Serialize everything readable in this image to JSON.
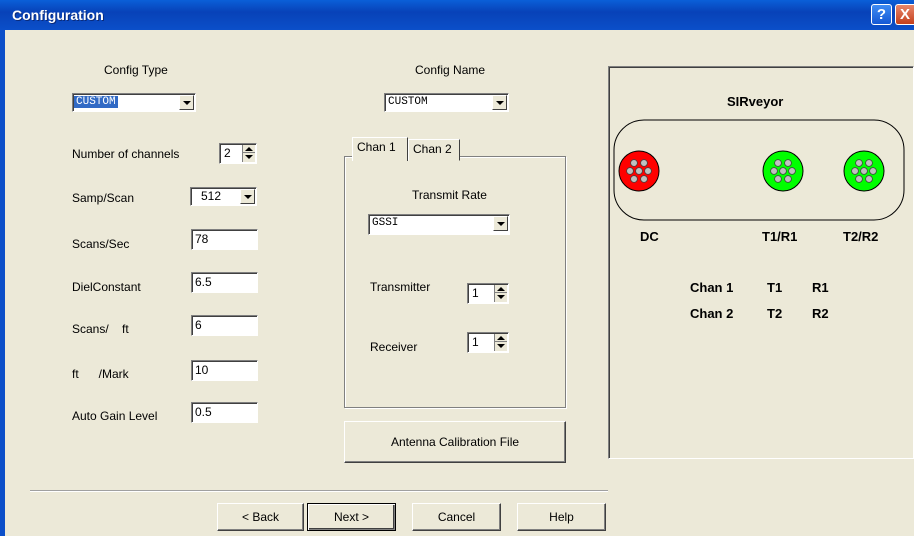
{
  "window": {
    "title": "Configuration",
    "help_glyph": "?",
    "close_glyph": "X"
  },
  "left": {
    "config_type_label": "Config Type",
    "config_type_value": "CUSTOM",
    "num_channels_label": "Number of channels",
    "num_channels_value": "2",
    "samp_scan_label": "Samp/Scan",
    "samp_scan_value": "512",
    "scans_sec_label": "Scans/Sec",
    "scans_sec_value": "78",
    "diel_label": "DielConstant",
    "diel_value": "6.5",
    "scans_ft_label": "Scans/    ft",
    "scans_ft_value": "6",
    "ft_mark_label": "ft      /Mark",
    "ft_mark_value": "10",
    "agc_label": "Auto Gain Level",
    "agc_value": "0.5"
  },
  "middle": {
    "config_name_label": "Config Name",
    "config_name_value": "CUSTOM",
    "tabs": [
      "Chan 1",
      "Chan 2"
    ],
    "transmit_rate_label": "Transmit Rate",
    "transmit_rate_value": "GSSI",
    "transmitter_label": "Transmitter",
    "transmitter_value": "1",
    "receiver_label": "Receiver",
    "receiver_value": "1",
    "calib_button": "Antenna Calibration File"
  },
  "sirveyor": {
    "title": "SIRveyor",
    "ports": [
      "DC",
      "T1/R1",
      "T2/R2"
    ],
    "port_colors": {
      "dc": "#ff0000",
      "t1r1": "#00ff00",
      "t2r2": "#00ff00"
    },
    "rows": [
      {
        "chan": "Chan 1",
        "t": "T1",
        "r": "R1"
      },
      {
        "chan": "Chan 2",
        "t": "T2",
        "r": "R2"
      }
    ]
  },
  "footer": {
    "back": "< Back",
    "next": "Next >",
    "cancel": "Cancel",
    "help": "Help"
  }
}
